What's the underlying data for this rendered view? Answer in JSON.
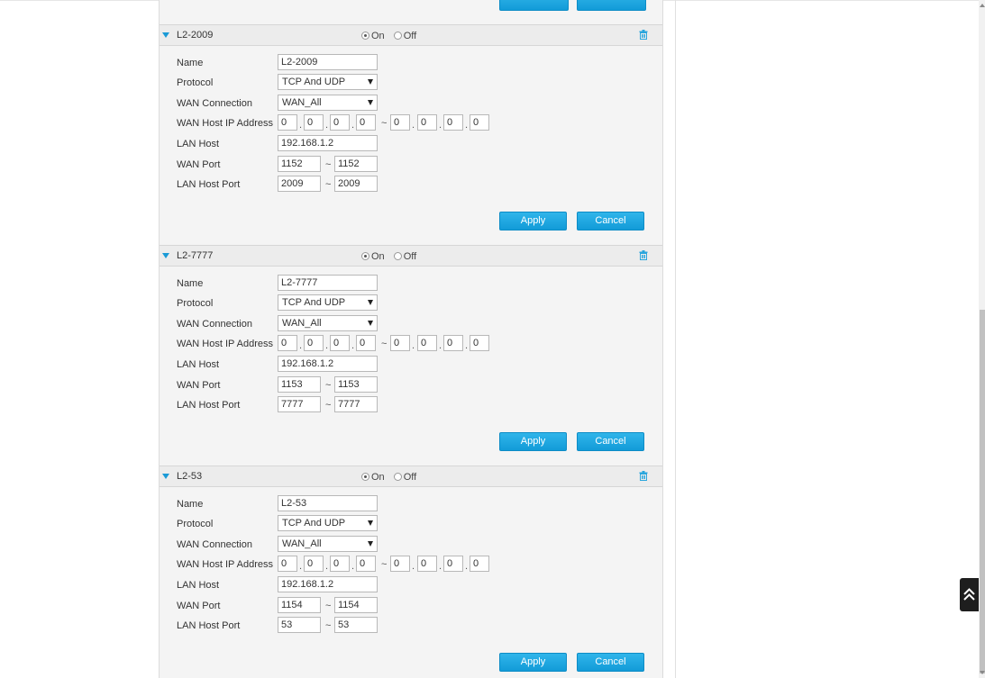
{
  "colors": {
    "accent": "#1a9ad6",
    "button_blue": "#129bd8",
    "panel_bg": "#f4f4f4",
    "header_bg": "#ececec"
  },
  "top_buttons": {
    "apply_label": "Apply",
    "cancel_label": "Cancel"
  },
  "labels": {
    "name": "Name",
    "protocol": "Protocol",
    "wan_connection": "WAN Connection",
    "wan_host_ip": "WAN Host IP Address",
    "lan_host": "LAN Host",
    "wan_port": "WAN Port",
    "lan_host_port": "LAN Host Port",
    "on": "On",
    "off": "Off",
    "apply": "Apply",
    "cancel": "Cancel",
    "tilde": "~",
    "dot": "."
  },
  "icons": {
    "collapse": "triangle-down-icon",
    "delete": "trash-icon",
    "back_to_top": "double-chevron-up-icon"
  },
  "sections": [
    {
      "title": "L2-2009",
      "enabled": "On",
      "name": "L2-2009",
      "protocol": "TCP And UDP",
      "wan_connection": "WAN_All",
      "wan_ip_start": [
        "0",
        "0",
        "0",
        "0"
      ],
      "wan_ip_end": [
        "0",
        "0",
        "0",
        "0"
      ],
      "lan_host": "192.168.1.2",
      "wan_port_start": "1152",
      "wan_port_end": "1152",
      "lan_port_start": "2009",
      "lan_port_end": "2009"
    },
    {
      "title": "L2-7777",
      "enabled": "On",
      "name": "L2-7777",
      "protocol": "TCP And UDP",
      "wan_connection": "WAN_All",
      "wan_ip_start": [
        "0",
        "0",
        "0",
        "0"
      ],
      "wan_ip_end": [
        "0",
        "0",
        "0",
        "0"
      ],
      "lan_host": "192.168.1.2",
      "wan_port_start": "1153",
      "wan_port_end": "1153",
      "lan_port_start": "7777",
      "lan_port_end": "7777"
    },
    {
      "title": "L2-53",
      "enabled": "On",
      "name": "L2-53",
      "protocol": "TCP And UDP",
      "wan_connection": "WAN_All",
      "wan_ip_start": [
        "0",
        "0",
        "0",
        "0"
      ],
      "wan_ip_end": [
        "0",
        "0",
        "0",
        "0"
      ],
      "lan_host": "192.168.1.2",
      "wan_port_start": "1154",
      "wan_port_end": "1154",
      "lan_port_start": "53",
      "lan_port_end": "53"
    }
  ]
}
